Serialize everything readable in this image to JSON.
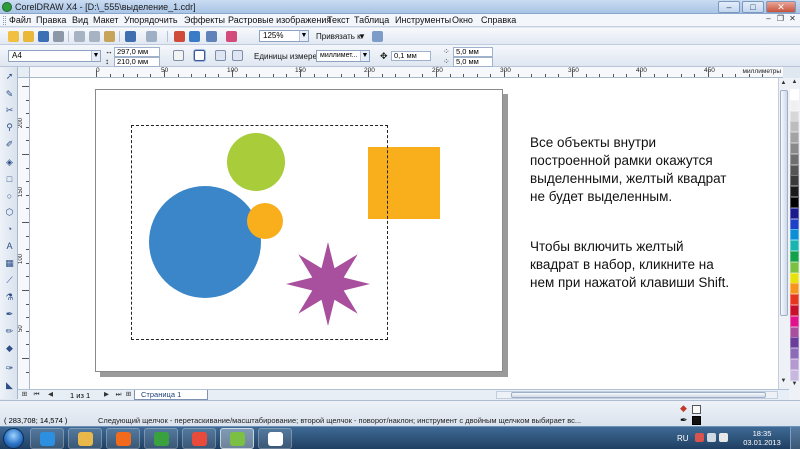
{
  "window": {
    "title": "CorelDRAW X4 - [D:\\_555\\выделение_1.cdr]",
    "minimize": "–",
    "maximize": "□",
    "close": "✕"
  },
  "menu": {
    "items": [
      "Файл",
      "Правка",
      "Вид",
      "Макет",
      "Упорядочить",
      "Эффекты",
      "Растровые изображения",
      "Текст",
      "Таблица",
      "Инструменты",
      "Окно",
      "Справка"
    ]
  },
  "toolbar": {
    "zoom": "125%",
    "snap_label": "Привязать к"
  },
  "property_bar": {
    "paper_size": "A4",
    "width": "297,0 мм",
    "height": "210,0 мм",
    "units_label": "Единицы измерения:",
    "units_value": "миллимет...",
    "nudge": "0,1 мм",
    "dup_x": "5,0 мм",
    "dup_y": "5,0 мм"
  },
  "ruler": {
    "unit": "миллиметры",
    "h_labels": [
      "0",
      "50",
      "100",
      "150",
      "200",
      "250",
      "300",
      "350",
      "400",
      "450",
      "500"
    ],
    "v_labels": [
      "200",
      "150",
      "100",
      "50"
    ]
  },
  "canvas": {
    "instruction_1": "Все объекты внутри построенной рамки окажутся выделенными, желтый квадрат не будет выделенным.",
    "instruction_2": "Чтобы включить желтый квадрат в набор, кликните на нем при нажатой клавиши Shift.",
    "shape_colors": {
      "green_circle": "#a8cc3a",
      "blue_circle": "#3a86c8",
      "orange_circle": "#f9ae1c",
      "orange_square": "#f9ae1c",
      "purple_star": "#a8509e"
    }
  },
  "pages": {
    "count": "1 из 1",
    "tab": "Страница 1"
  },
  "status": {
    "coords": "( 283,708; 14,574 )",
    "hint": "Следующий щелчок - перетаскивание/масштабирование; второй щелчок - поворот/наклон; инструмент с двойным щелчком выбирает вс..."
  },
  "palette": {
    "colors": [
      "#ffffff",
      "#f0f0f0",
      "#d8d8d8",
      "#bdbdbd",
      "#a3a3a3",
      "#8a8a8a",
      "#6f6f6f",
      "#555555",
      "#3a3a3a",
      "#1a1a1a",
      "#000000",
      "#1a1a8c",
      "#1e3fc8",
      "#0a8fd6",
      "#18b4b0",
      "#12a04a",
      "#7ac143",
      "#e8e20c",
      "#f7941d",
      "#e8351f",
      "#c8102e",
      "#e0118a",
      "#a8509e",
      "#6a3d9a",
      "#8c6bb8",
      "#b49ad0",
      "#c8b8e0"
    ]
  },
  "taskbar": {
    "language": "RU",
    "time": "18:35",
    "date": "03.01.2013",
    "app_colors": [
      "#2d8fe0",
      "#e8b84a",
      "#f26b1d",
      "#3aa13f",
      "#e84b3c",
      "#7bc043",
      "#ffffff"
    ]
  }
}
